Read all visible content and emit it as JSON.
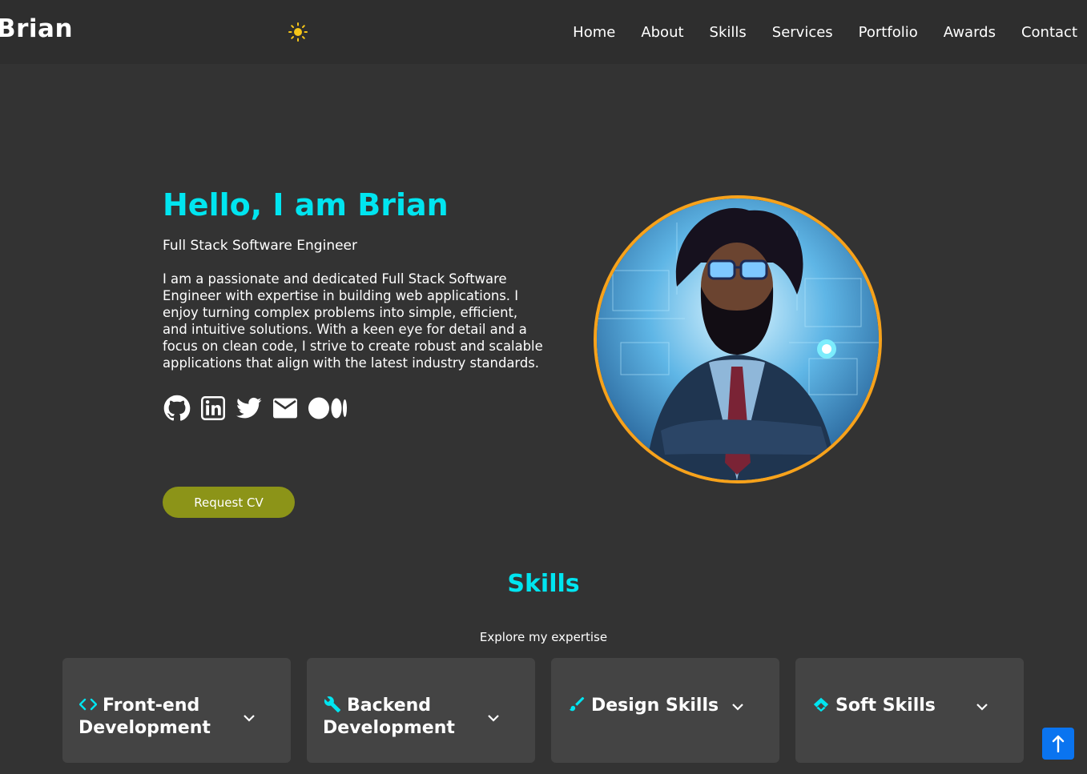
{
  "header": {
    "brand": "Brian",
    "theme_icon": "sun-icon",
    "nav": [
      "Home",
      "About",
      "Skills",
      "Services",
      "Portfolio",
      "Awards",
      "Contact"
    ]
  },
  "hero": {
    "title": "Hello, I am Brian",
    "role": "Full Stack Software Engineer",
    "description": "I am a passionate and dedicated Full Stack Software Engineer with expertise in building web applications. I enjoy turning complex problems into simple, efficient, and intuitive solutions. With a keen eye for detail and a focus on clean code, I strive to create robust and scalable applications that align with the latest industry standards.",
    "socials": [
      "github-icon",
      "linkedin-icon",
      "twitter-icon",
      "email-icon",
      "medium-icon"
    ],
    "cv_button": "Request CV",
    "avatar": "profile-avatar"
  },
  "skills": {
    "title": "Skills",
    "subtitle": "Explore my expertise",
    "cards": [
      {
        "title": "Front-end Development",
        "icon": "code-icon"
      },
      {
        "title": "Backend Development",
        "icon": "wrench-icon"
      },
      {
        "title": "Design Skills",
        "icon": "brush-icon"
      },
      {
        "title": "Soft Skills",
        "icon": "handshake-icon"
      }
    ]
  },
  "colors": {
    "background": "#333333",
    "header": "#2e2e2e",
    "accent": "#00e5f0",
    "cv_button": "#8c9418",
    "avatar_border": "#f7a21b",
    "card": "#444444",
    "scroll_top": "#0a74f0"
  },
  "scroll_top_icon": "arrow-up-icon"
}
